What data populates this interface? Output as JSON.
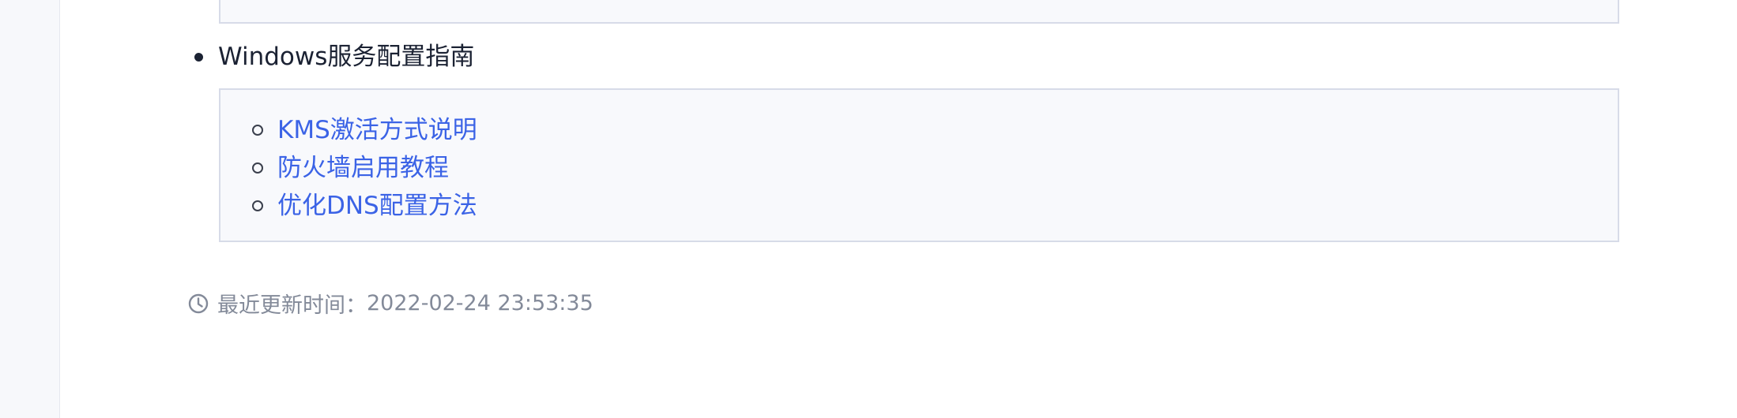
{
  "section": {
    "title": "Windows服务配置指南",
    "links": [
      {
        "label": "KMS激活方式说明"
      },
      {
        "label": "防火墙启用教程"
      },
      {
        "label": "优化DNS配置方法"
      }
    ]
  },
  "footer": {
    "updated_label": "最近更新时间：",
    "updated_value": "2022-02-24 23:53:35"
  },
  "colors": {
    "link": "#3b63e6",
    "text": "#1b2233",
    "muted": "#838a99",
    "box_bg": "#f8f9fc",
    "box_border": "#d7dbe8"
  },
  "icons": {
    "updated": "clock-icon"
  }
}
